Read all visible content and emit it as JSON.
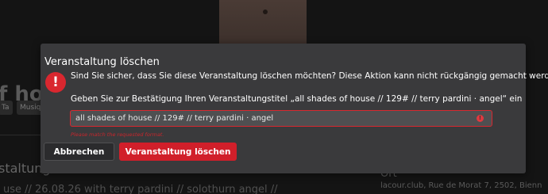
{
  "background": {
    "heading": "f hous",
    "tags": [
      "Ta",
      "Musiqu"
    ],
    "subheading": "staltung",
    "info_line": "use // 26.08.26 with terry pardini // solothurn angel //",
    "location_label": "Ort",
    "address": "lacour.club, Rue de Morat 7, 2502, Bienn"
  },
  "modal": {
    "title": "Veranstaltung löschen",
    "confirm_text": "Sind Sie sicher, dass Sie diese Veranstaltung löschen möchten? Diese Aktion kann nicht rückgängig gemacht werden.",
    "instruction_text": "Geben Sie zur Bestätigung Ihren Veranstaltungstitel „all shades of house // 129# // terry pardini · angel“ ein",
    "input_value": "all shades of house // 129# // terry pardini · angel",
    "error_message": "Please match the requested format.",
    "cancel_label": "Abbrechen",
    "delete_label": "Veranstaltung löschen",
    "alert_glyph": "!",
    "input_error_glyph": "!"
  },
  "colors": {
    "danger": "#d11f2a",
    "modal_bg": "#3a3a3c",
    "page_bg": "#141414"
  },
  "icons": {
    "alert": "exclamation-circle-icon",
    "input_error": "exclamation-circle-icon"
  }
}
